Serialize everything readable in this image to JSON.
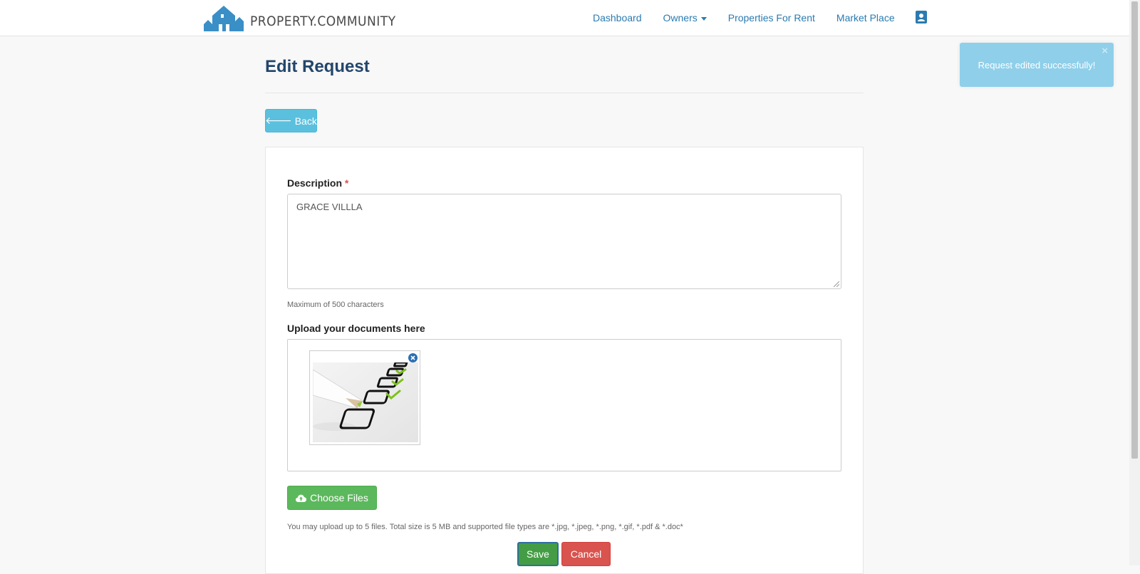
{
  "navbar": {
    "brand": "PROPERTY.COMMUNITY",
    "links": [
      "Dashboard",
      "Owners",
      "Properties For Rent",
      "Market Place"
    ],
    "profile_icon": "contact-card-icon"
  },
  "page": {
    "title": "Edit Request",
    "back_label": "Back"
  },
  "form": {
    "description_label": "Description",
    "required_mark": "*",
    "description_value": "GRACE VILLLA",
    "description_help": "Maximum of 500 characters",
    "upload_label": "Upload your documents here",
    "choose_files_label": "Choose Files",
    "upload_help": "You may upload up to 5 files. Total size is 5 MB and supported file types are *.jpg, *.jpeg, *.png, *.gif, *.pdf & *.doc*",
    "save_label": "Save",
    "cancel_label": "Cancel"
  },
  "toast": {
    "message": "Request edited successfully!",
    "close": "×"
  },
  "colors": {
    "brand_blue": "#3a8fc7",
    "title_navy": "#23466b",
    "info": "#5bc0de",
    "success": "#5cb85c",
    "danger": "#d9534f"
  }
}
